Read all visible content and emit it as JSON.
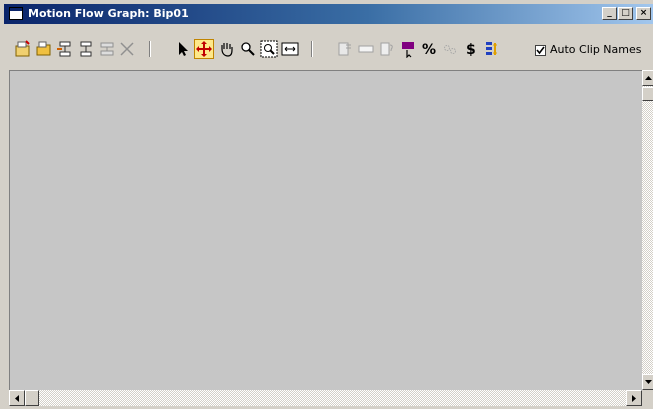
{
  "window": {
    "title": "Motion Flow Graph: Bip01",
    "buttons": {
      "minimize": "_",
      "maximize": "□",
      "close": "×"
    }
  },
  "toolbar": {
    "tools": [
      {
        "name": "create-clip",
        "icon": "new-clip-icon"
      },
      {
        "name": "open-clip",
        "icon": "open-folder-icon"
      },
      {
        "name": "create-transition",
        "icon": "transition-icon"
      },
      {
        "name": "create-transitions-multi",
        "icon": "transitions-icon"
      },
      {
        "name": "create-random-transitions",
        "icon": "random-transitions-icon"
      },
      {
        "name": "delete",
        "icon": "delete-icon"
      },
      {
        "name": "select",
        "icon": "arrow-icon"
      },
      {
        "name": "move-clips",
        "icon": "move-icon",
        "active": true
      },
      {
        "name": "pan",
        "icon": "hand-icon"
      },
      {
        "name": "zoom",
        "icon": "magnifier-icon"
      },
      {
        "name": "zoom-region",
        "icon": "zoom-region-icon"
      },
      {
        "name": "zoom-extents",
        "icon": "zoom-extents-icon"
      },
      {
        "name": "show-scripts",
        "icon": "script-icon"
      },
      {
        "name": "show-clip",
        "icon": "clip-icon"
      },
      {
        "name": "show-properties",
        "icon": "properties-icon"
      },
      {
        "name": "select-random-start",
        "icon": "flag-icon"
      },
      {
        "name": "optimize-transitions",
        "icon": "percent-icon"
      },
      {
        "name": "select-all",
        "icon": "gear-icon"
      },
      {
        "name": "set-random-start",
        "icon": "dollar-icon"
      },
      {
        "name": "distribute",
        "icon": "distribute-icon"
      }
    ],
    "auto_clip_names": {
      "label": "Auto Clip Names",
      "checked": true
    }
  },
  "colors": {
    "title_start": "#0a246a",
    "title_end": "#a6caf0",
    "canvas": "#c6c6c6",
    "chrome": "#d4d0c8",
    "active_tool": "#fee88a"
  }
}
